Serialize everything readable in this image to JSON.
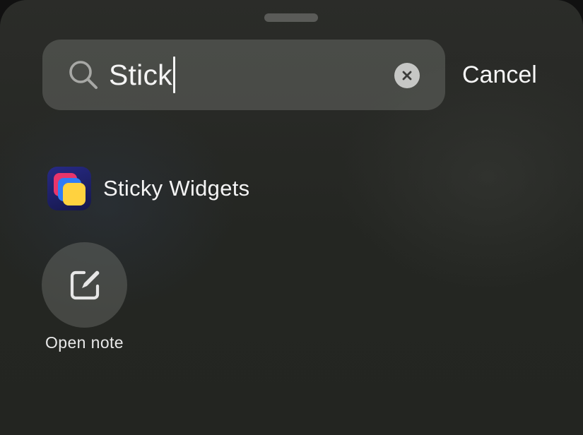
{
  "search": {
    "query": "Stick",
    "cancel_label": "Cancel",
    "search_icon": "magnifying-glass",
    "clear_icon": "x-mark"
  },
  "results": {
    "app": {
      "name": "Sticky Widgets",
      "icon": "sticky-widgets-app-icon",
      "icon_colors": [
        "#e8356b",
        "#2f7cf6",
        "#ffd23f"
      ]
    },
    "actions": [
      {
        "label": "Open note",
        "icon": "compose-icon"
      }
    ]
  },
  "colors": {
    "background": "#262824",
    "field": "#4b4e49",
    "text": "#f4f4f4"
  }
}
